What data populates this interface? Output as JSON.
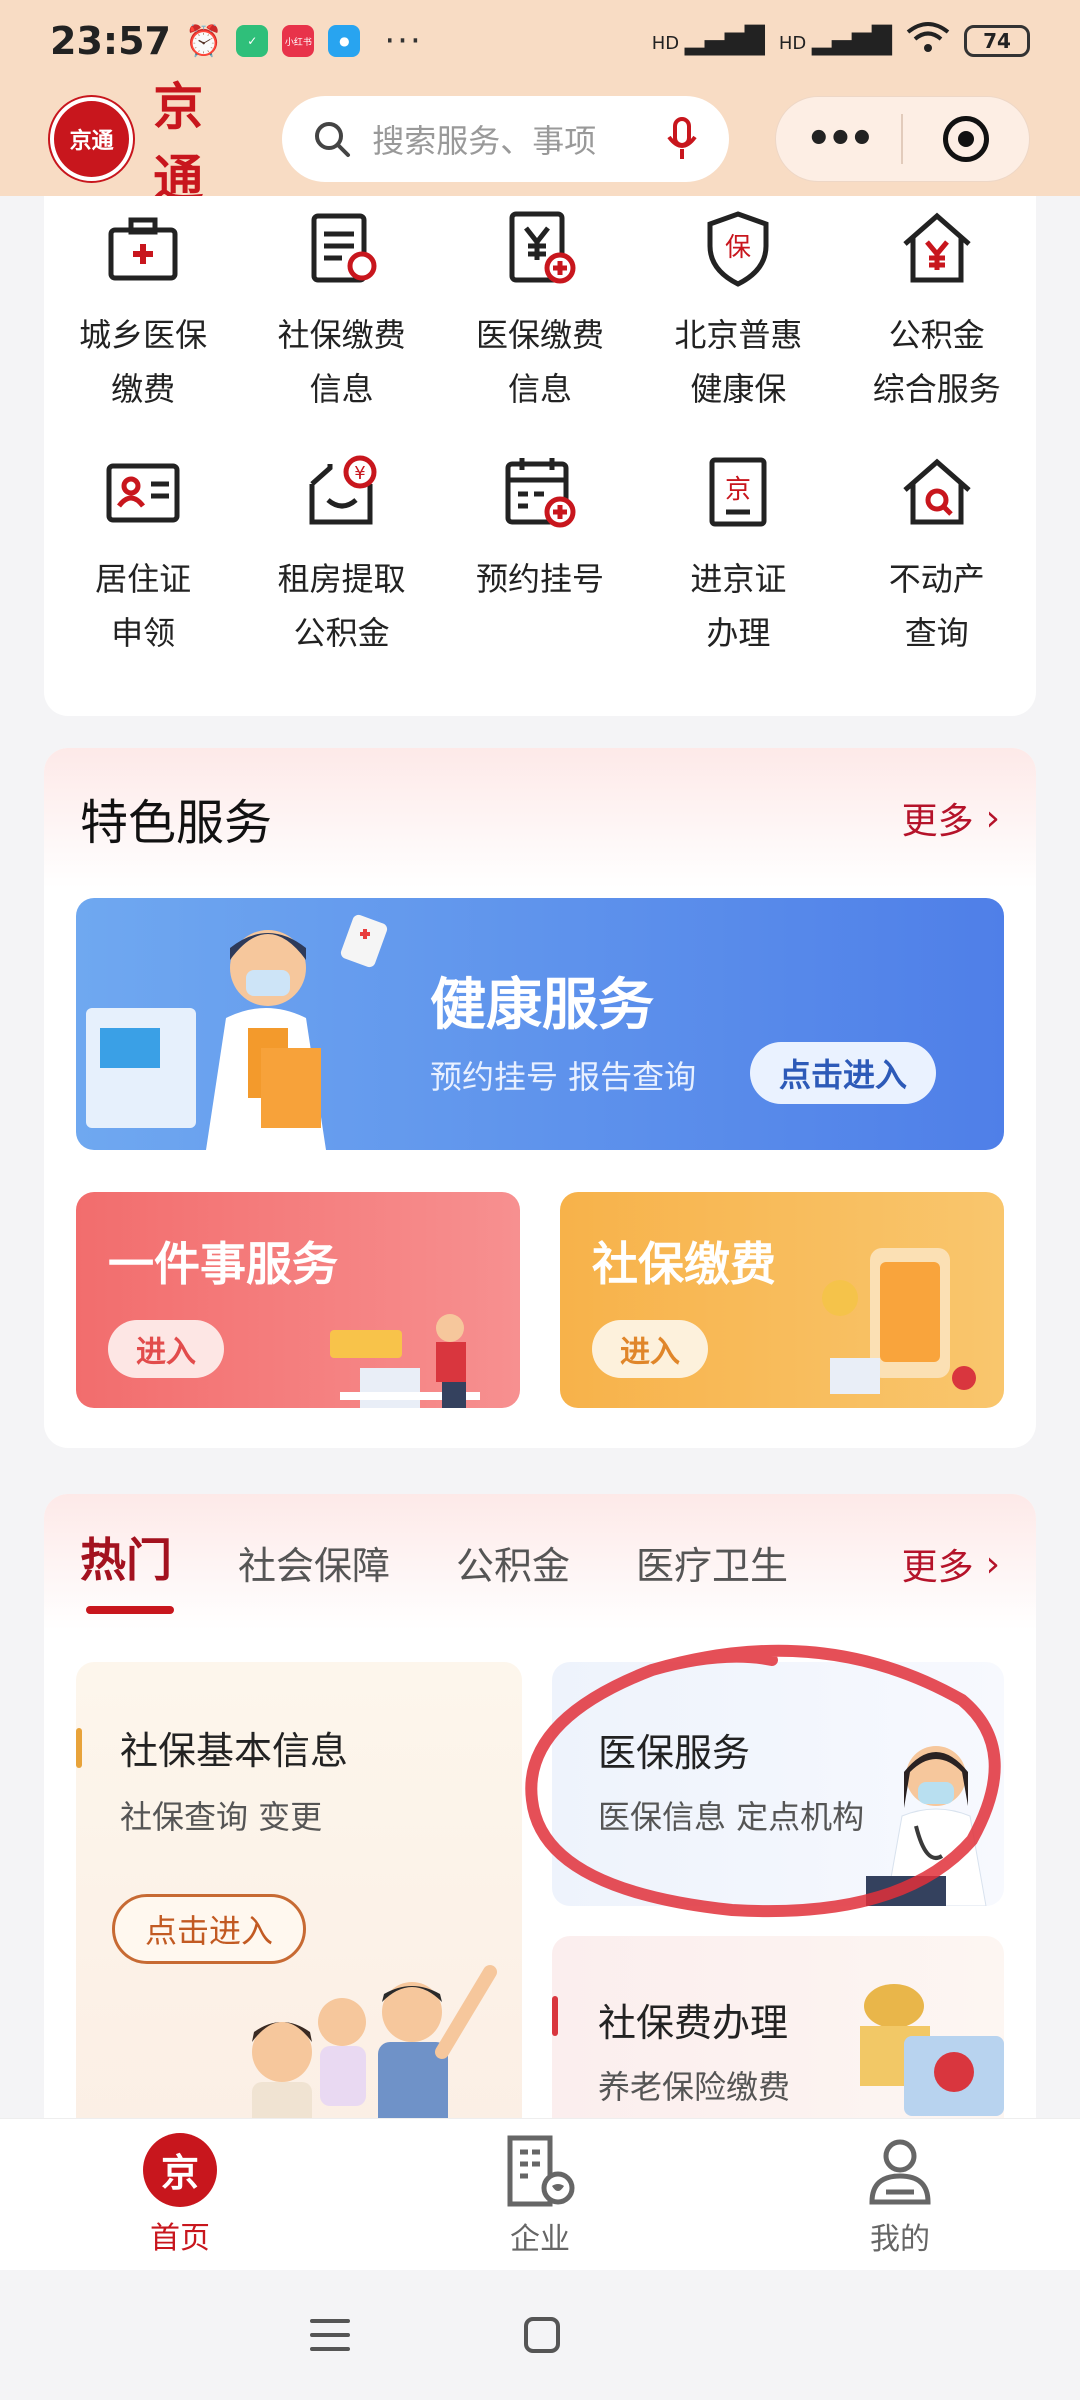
{
  "status_bar": {
    "time": "23:57",
    "app_badge": "小红书",
    "net1": "HD",
    "net2": "HD",
    "battery": "74"
  },
  "header": {
    "logo_text": "京通",
    "title": "京通",
    "search_placeholder": "搜索服务、事项"
  },
  "grid": [
    {
      "label": "城乡医保\n缴费",
      "icon": "medical-kit-icon"
    },
    {
      "label": "社保缴费\n信息",
      "icon": "document-icon"
    },
    {
      "label": "医保缴费\n信息",
      "icon": "yuan-document-icon"
    },
    {
      "label": "北京普惠\n健康保",
      "icon": "shield-icon"
    },
    {
      "label": "公积金\n综合服务",
      "icon": "house-yuan-icon"
    },
    {
      "label": "居住证\n申领",
      "icon": "id-card-icon"
    },
    {
      "label": "租房提取\n公积金",
      "icon": "envelope-yuan-icon"
    },
    {
      "label": "预约挂号",
      "icon": "calendar-plus-icon"
    },
    {
      "label": "进京证\n办理",
      "icon": "permit-icon"
    },
    {
      "label": "不动产\n查询",
      "icon": "house-search-icon"
    }
  ],
  "featured": {
    "title": "特色服务",
    "more": "更多",
    "health": {
      "title": "健康服务",
      "subtitle": "预约挂号 报告查询",
      "button": "点击进入"
    },
    "one_thing": {
      "title": "一件事服务",
      "button": "进入"
    },
    "social_fee": {
      "title": "社保缴费",
      "button": "进入"
    }
  },
  "hot": {
    "tabs": [
      "热门",
      "社会保障",
      "公积金",
      "医疗卫生"
    ],
    "more": "更多",
    "card1": {
      "title": "社保基本信息",
      "subtitle": "社保查询 变更",
      "button": "点击进入"
    },
    "card2": {
      "title": "医保服务",
      "subtitle": "医保信息 定点机构"
    },
    "card3": {
      "title": "社保费办理",
      "subtitle": "养老保险缴费"
    }
  },
  "bottom_nav": [
    {
      "label": "首页",
      "icon": "home-jing-icon",
      "active": true
    },
    {
      "label": "企业",
      "icon": "building-icon",
      "active": false
    },
    {
      "label": "我的",
      "icon": "person-icon",
      "active": false
    }
  ],
  "colors": {
    "brand_red": "#c8161d",
    "header_bg": "#f8dcc4",
    "annotation_circle": "#e0303a"
  }
}
